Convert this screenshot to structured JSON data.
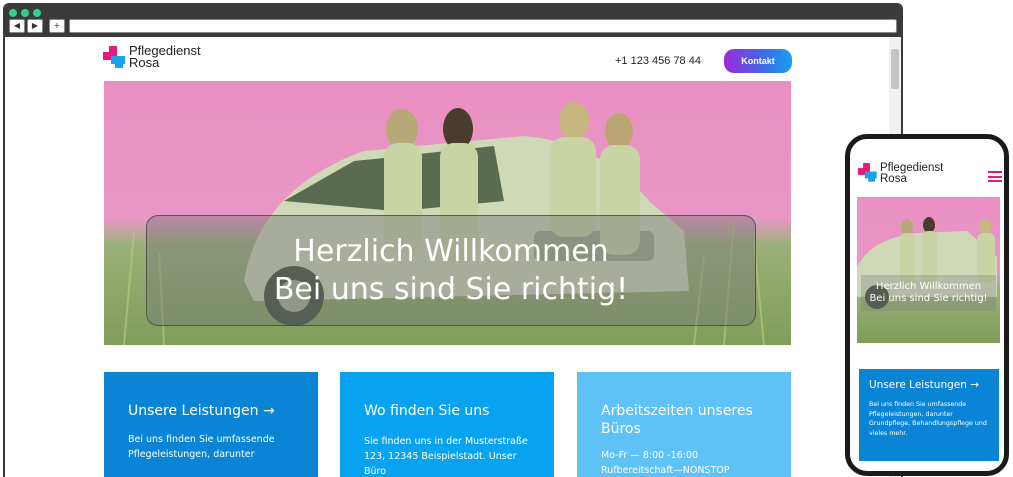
{
  "desktop": {
    "logo": {
      "line1": "Pflegedienst",
      "line2": "Rosa"
    },
    "header": {
      "phone": "+1 123 456 78 44",
      "contact_label": "Kontakt"
    },
    "hero": {
      "line1": "Herzlich Willkommen",
      "line2": "Bei uns sind Sie richtig!"
    },
    "cards": [
      {
        "title": "Unsere Leistungen →",
        "body": "Bei uns finden Sie umfassende Pflegeleistungen, darunter",
        "color": "#0a84d4"
      },
      {
        "title": "Wo finden Sie uns",
        "body": "Sie finden uns in der Musterstraße 123, 12345 Beispielstadt. Unser Büro",
        "color": "#07a3f0"
      },
      {
        "title": "Arbeitszeiten unseres Büros",
        "body_line1": "Mo-Fr — 8:00 -16:00",
        "body_line2": "Rufbereitschaft—NONSTOP",
        "color": "#5ec2f7"
      }
    ]
  },
  "mobile": {
    "logo": {
      "line1": "Pflegedienst",
      "line2": "Rosa"
    },
    "hero": {
      "line1": "Herzlich Willkommen",
      "line2": "Bei uns sind Sie richtig!"
    },
    "card": {
      "title": "Unsere Leistungen →",
      "body": "Bei uns finden Sie umfassende Pflegeleistungen, darunter Grundpflege, Behandlungspflege und vieles mehr.",
      "color": "#0a84d4"
    }
  },
  "icons": {
    "menu": "hamburger-menu-icon",
    "back": "arrow-left-icon",
    "forward": "arrow-right-icon",
    "new_tab": "plus-icon",
    "logo": "cross-logo-icon"
  },
  "colors": {
    "brand_pink": "#e6197d",
    "brand_blue": "#1ea0e6",
    "chrome": "#3a3a3a"
  }
}
